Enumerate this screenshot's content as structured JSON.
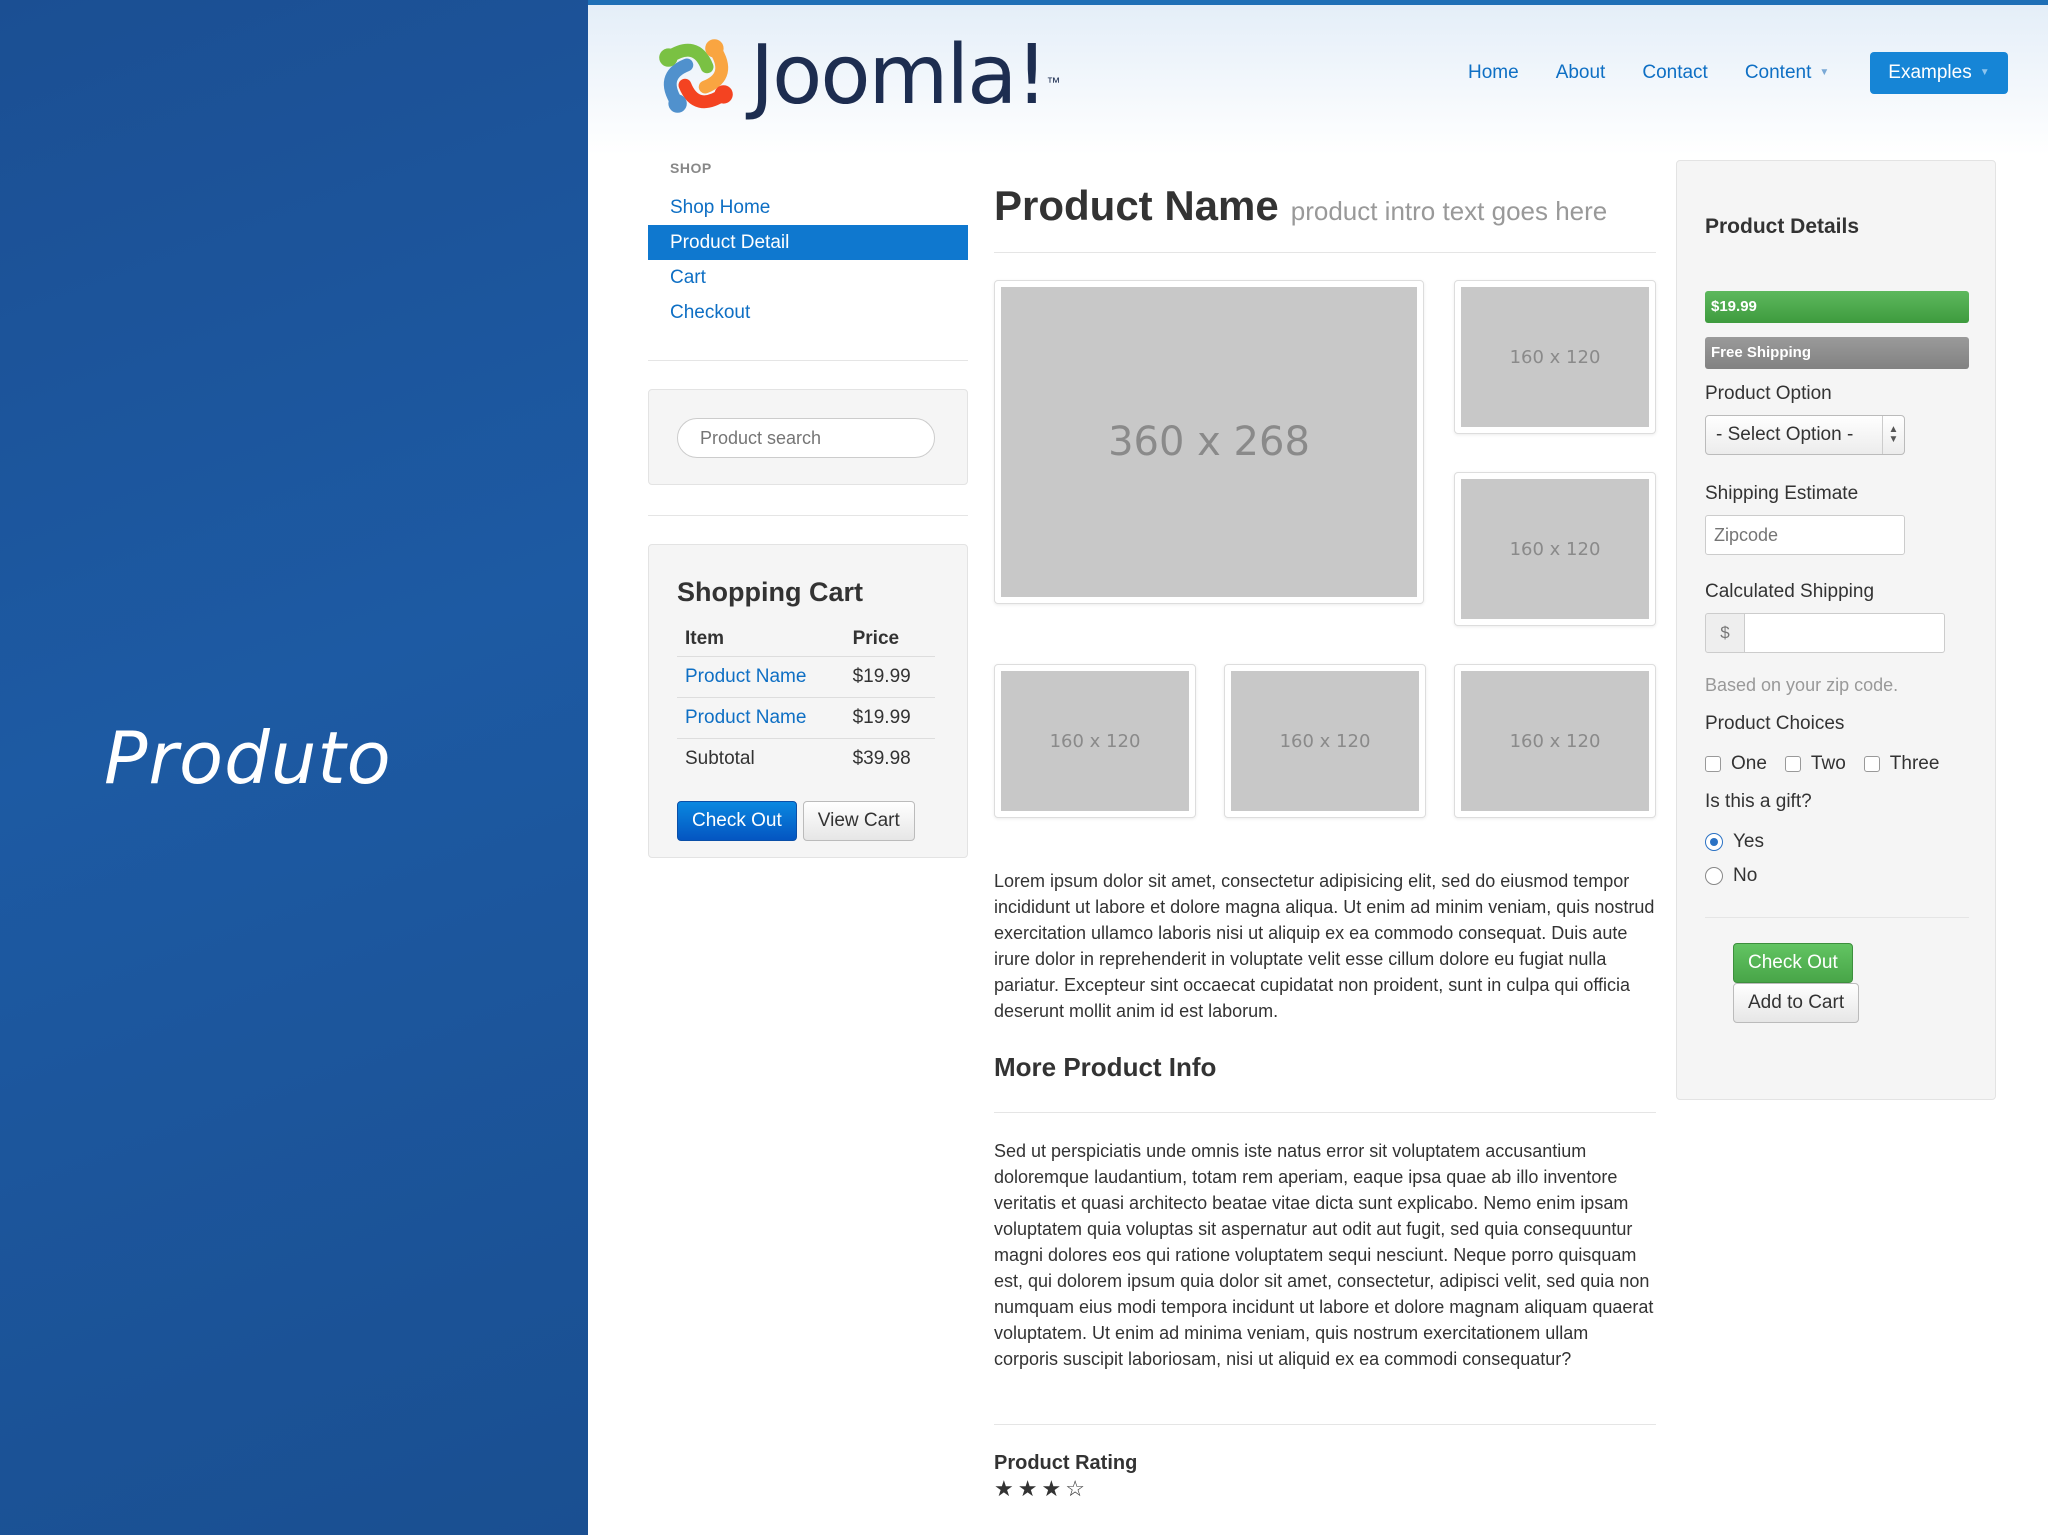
{
  "slide": {
    "title": "Produto"
  },
  "brand": {
    "name": "Joomla!",
    "tm": "™"
  },
  "nav": {
    "items": [
      "Home",
      "About",
      "Contact",
      "Content"
    ],
    "button": "Examples"
  },
  "sidebar": {
    "heading": "SHOP",
    "items": [
      "Shop Home",
      "Product Detail",
      "Cart",
      "Checkout"
    ],
    "active_index": 1,
    "search_placeholder": "Product search"
  },
  "cart": {
    "title": "Shopping Cart",
    "columns": [
      "Item",
      "Price"
    ],
    "rows": [
      {
        "item": "Product Name",
        "price": "$19.99"
      },
      {
        "item": "Product Name",
        "price": "$19.99"
      }
    ],
    "subtotal_label": "Subtotal",
    "subtotal": "$39.98",
    "checkout_button": "Check Out",
    "view_button": "View Cart"
  },
  "product": {
    "title": "Product Name",
    "intro": "product intro text goes here",
    "main_image": "360 x 268",
    "thumb_label": "160 x 120",
    "description": "Lorem ipsum dolor sit amet, consectetur adipisicing elit, sed do eiusmod tempor incididunt ut labore et dolore magna aliqua. Ut enim ad minim veniam, quis nostrud exercitation ullamco laboris nisi ut aliquip ex ea commodo consequat. Duis aute irure dolor in reprehenderit in voluptate velit esse cillum dolore eu fugiat nulla pariatur. Excepteur sint occaecat cupidatat non proident, sunt in culpa qui officia deserunt mollit anim id est laborum.",
    "more_title": "More Product Info",
    "more_text": "Sed ut perspiciatis unde omnis iste natus error sit voluptatem accusantium doloremque laudantium, totam rem aperiam, eaque ipsa quae ab illo inventore veritatis et quasi architecto beatae vitae dicta sunt explicabo. Nemo enim ipsam voluptatem quia voluptas sit aspernatur aut odit aut fugit, sed quia consequuntur magni dolores eos qui ratione voluptatem sequi nesciunt. Neque porro quisquam est, qui dolorem ipsum quia dolor sit amet, consectetur, adipisci velit, sed quia non numquam eius modi tempora incidunt ut labore et dolore magnam aliquam quaerat voluptatem. Ut enim ad minima veniam, quis nostrum exercitationem ullam corporis suscipit laboriosam, nisi ut aliquid ex ea commodi consequatur?",
    "rating_title": "Product Rating",
    "rating": 3,
    "rating_max": 4
  },
  "details": {
    "title": "Product Details",
    "price": "$19.99",
    "shipping_badge": "Free Shipping",
    "option_label": "Product Option",
    "option_value": "- Select Option -",
    "shipping_label": "Shipping Estimate",
    "zip_placeholder": "Zipcode",
    "calc_label": "Calculated Shipping",
    "currency": "$",
    "help": "Based on your zip code.",
    "choices_label": "Product Choices",
    "choices": [
      "One",
      "Two",
      "Three"
    ],
    "gift_label": "Is this a gift?",
    "gift_options": [
      "Yes",
      "No"
    ],
    "gift_selected": "Yes",
    "checkout_button": "Check Out",
    "add_button": "Add to Cart"
  },
  "colors": {
    "slide_blue": "#1b4f93",
    "link_blue": "#0e6fc4",
    "active_blue": "#0f78cf",
    "success_green": "#48a548"
  }
}
